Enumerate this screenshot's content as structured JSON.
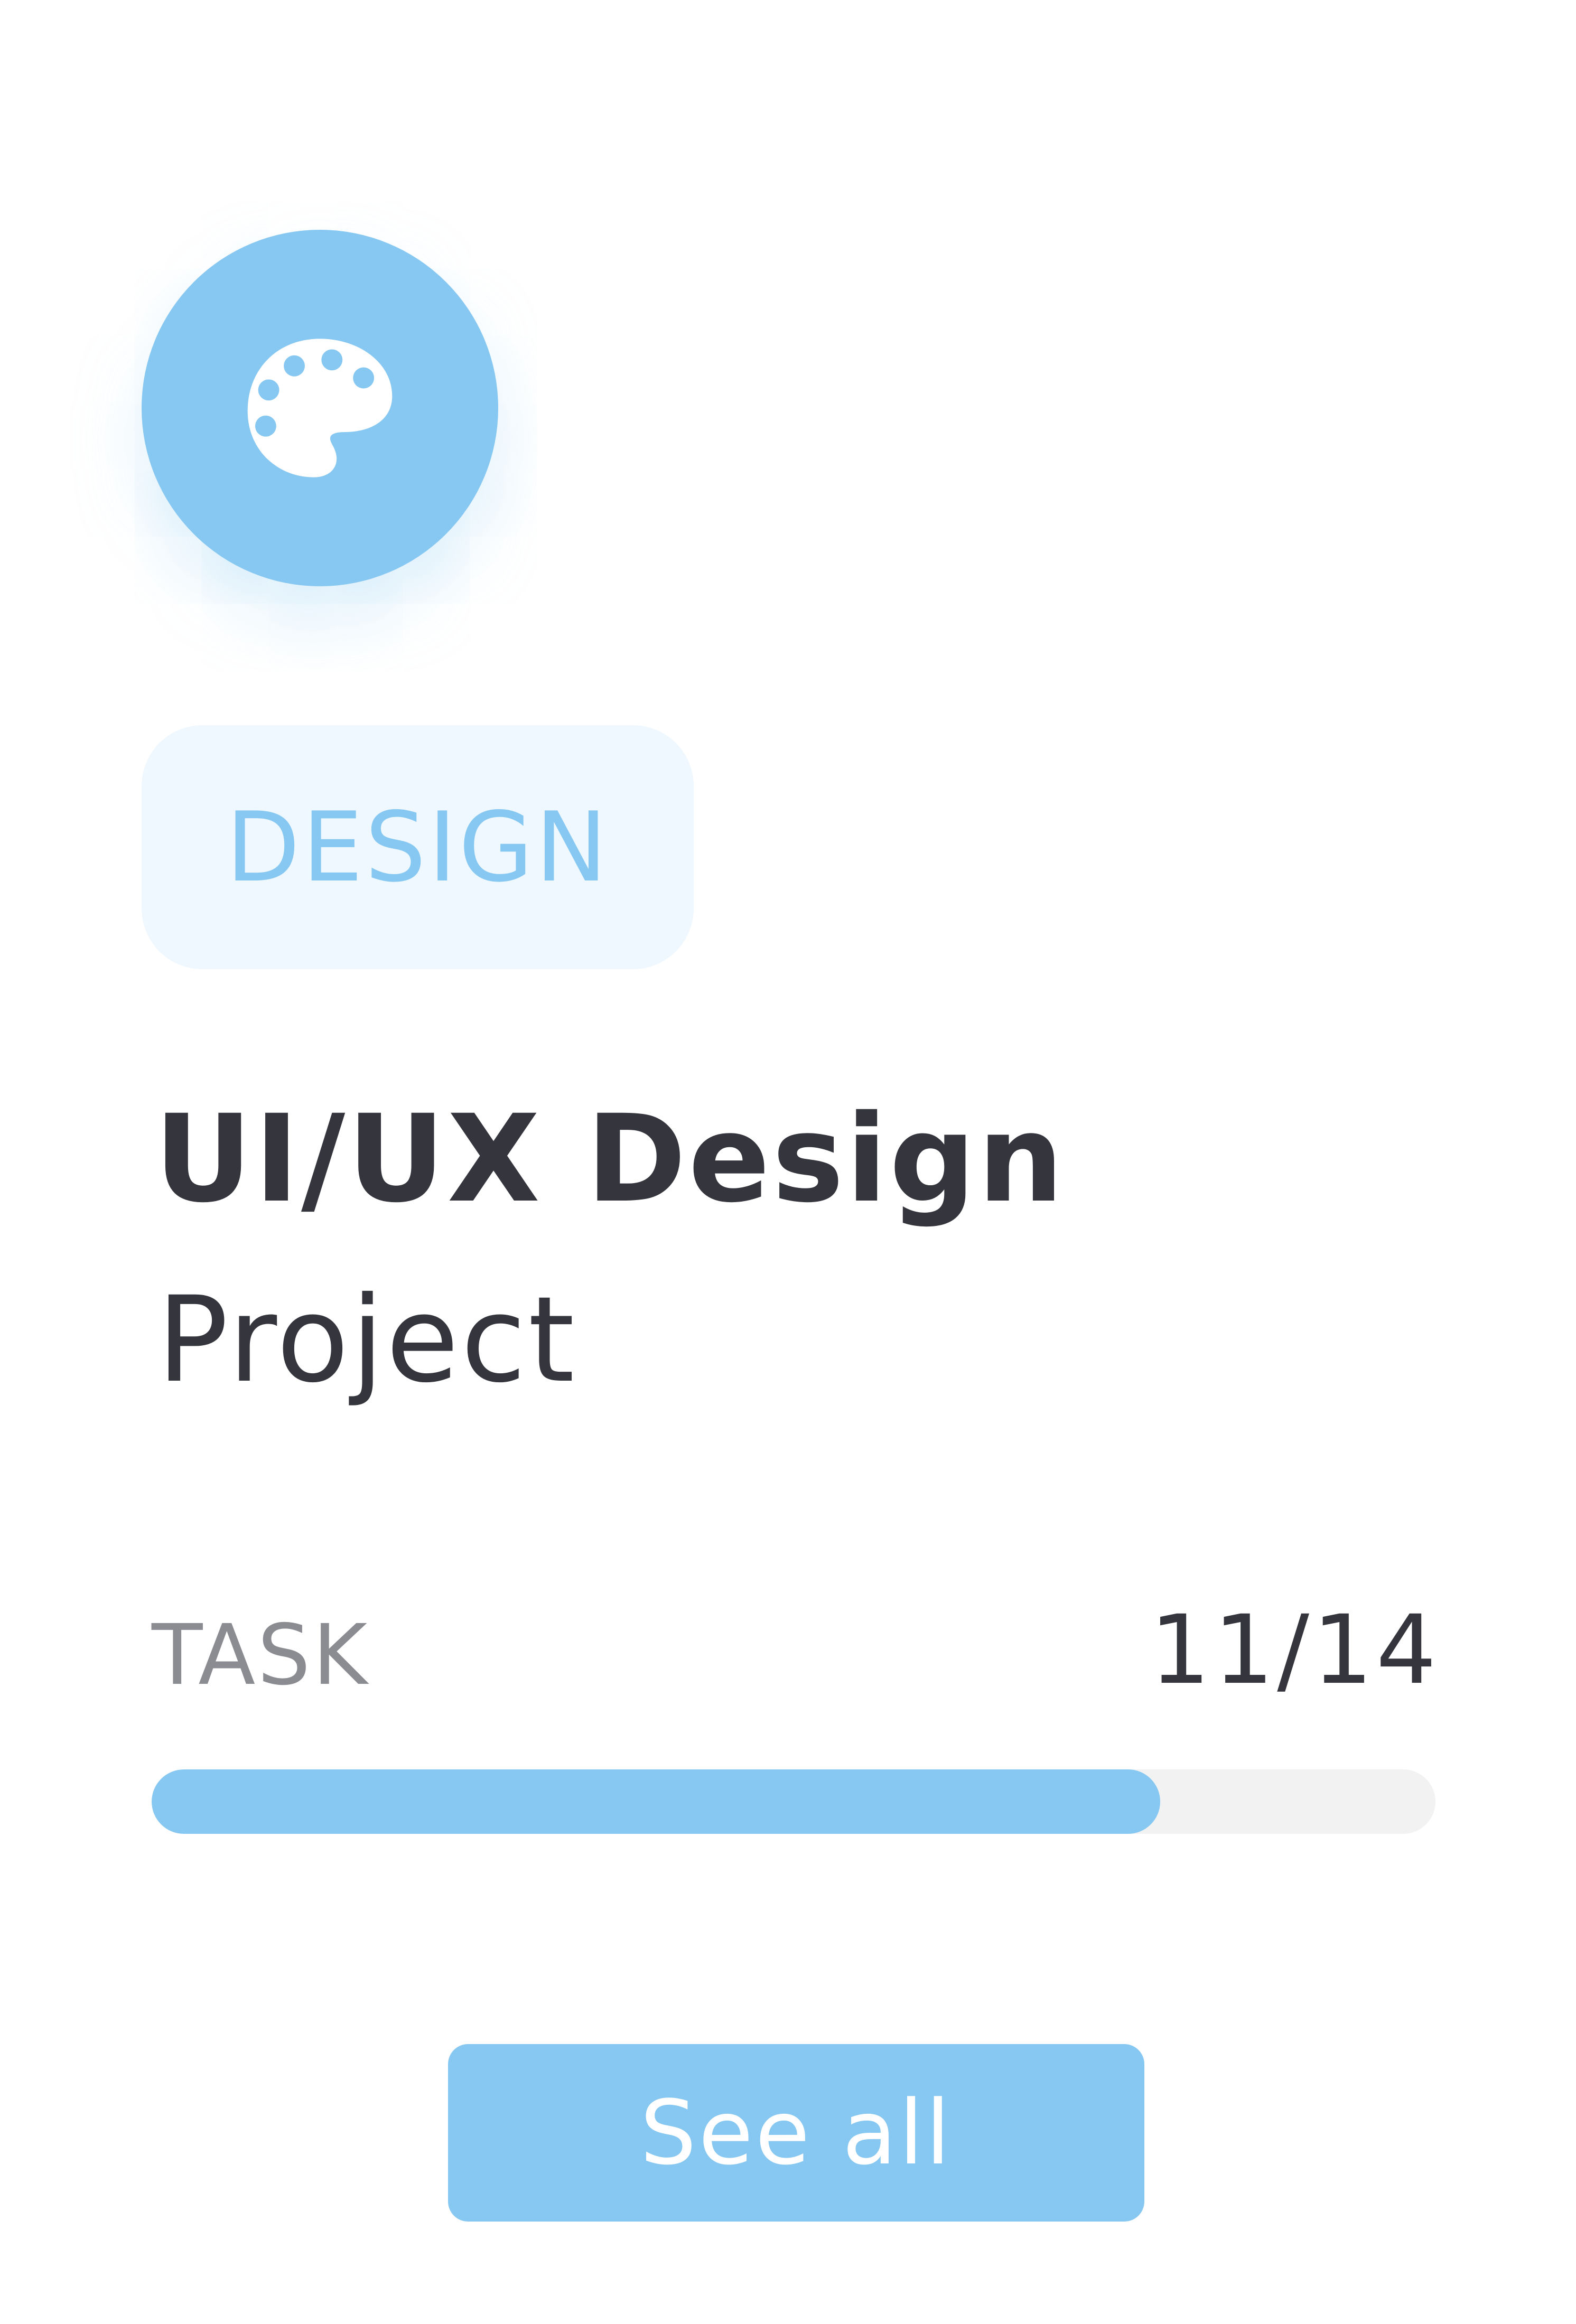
{
  "card": {
    "icon": "palette-icon",
    "accent_color": "#86c8f2",
    "tag": {
      "label": "DESIGN",
      "background": "#eff8ff"
    },
    "title": "UI/UX Design",
    "subtitle": "Project",
    "task": {
      "label": "TASK",
      "count_text": "11/14",
      "completed": 11,
      "total": 14
    },
    "button": {
      "label": "See all"
    }
  }
}
